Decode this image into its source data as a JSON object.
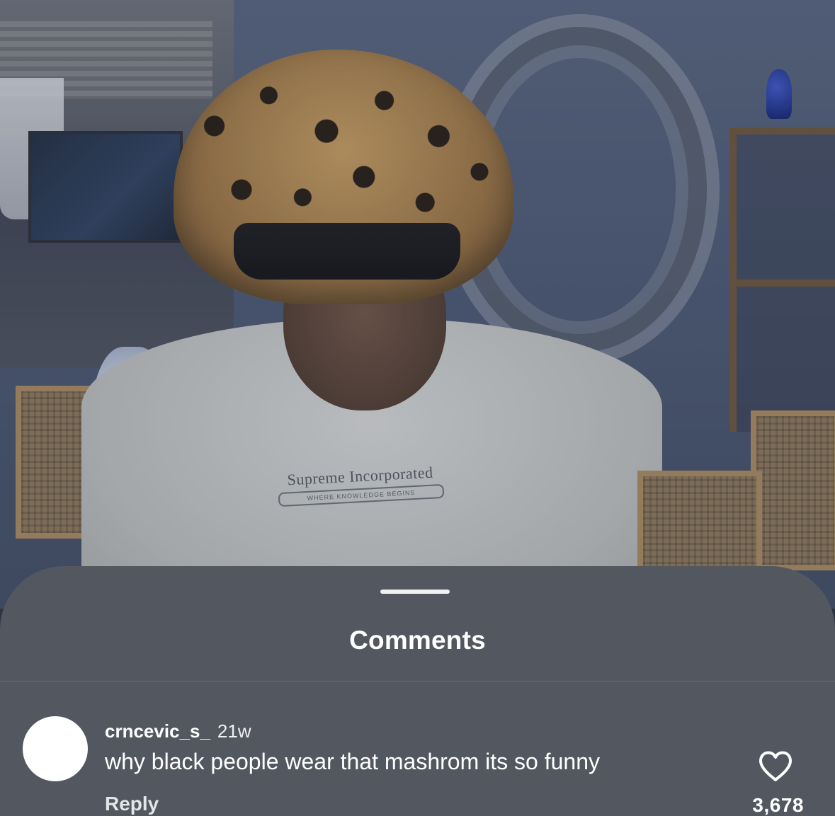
{
  "video": {
    "shirt_text": "Supreme Incorporated",
    "shirt_subtext": "WHERE KNOWLEDGE BEGINS"
  },
  "sheet": {
    "title": "Comments"
  },
  "comments": [
    {
      "username": "crncevic_s_",
      "time": "21w",
      "text": "why black people wear that mashrom its so funny",
      "reply_label": "Reply",
      "likes": "3,678",
      "like_icon": "heart-outline-icon"
    }
  ],
  "colors": {
    "sheet_background": "#535860",
    "text_primary": "#ffffff"
  }
}
